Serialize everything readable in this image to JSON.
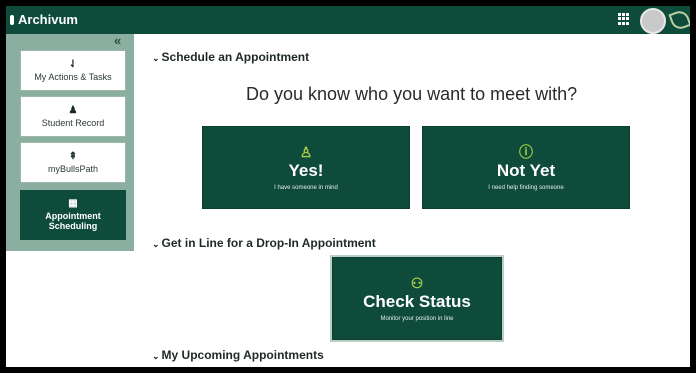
{
  "app": {
    "title": "Archivum"
  },
  "header": {
    "apps_icon": "grid-icon",
    "avatar": "avatar",
    "logo_icon": "bull-logo-icon"
  },
  "sidebar": {
    "collapse_label": "«",
    "items": [
      {
        "icon": "⇃",
        "label": "My Actions & Tasks"
      },
      {
        "icon": "♟",
        "label": "Student Record"
      },
      {
        "icon": "⇞",
        "label": "myBullsPath"
      },
      {
        "icon": "▦",
        "label": "Appointment Scheduling"
      }
    ]
  },
  "main": {
    "sections": [
      {
        "chevron": "⌄",
        "title": "Schedule an Appointment"
      },
      {
        "chevron": "⌄",
        "title": "Get in Line for a Drop-In Appointment"
      },
      {
        "chevron": "⌄",
        "title": "My Upcoming Appointments"
      }
    ],
    "question": "Do you know who you want to meet with?",
    "tiles": {
      "yes": {
        "icon": "♙",
        "label": "Yes!",
        "sub": "I have someone in mind"
      },
      "notyet": {
        "icon": "ⓘ",
        "label": "Not Yet",
        "sub": "I need help finding someone"
      },
      "check": {
        "icon": "⚇",
        "label": "Check Status",
        "sub": "Monitor your position in line"
      }
    }
  },
  "colors": {
    "primary": "#0f4b3a",
    "accent": "#a8cf45",
    "sidebar": "#8aaea0"
  }
}
